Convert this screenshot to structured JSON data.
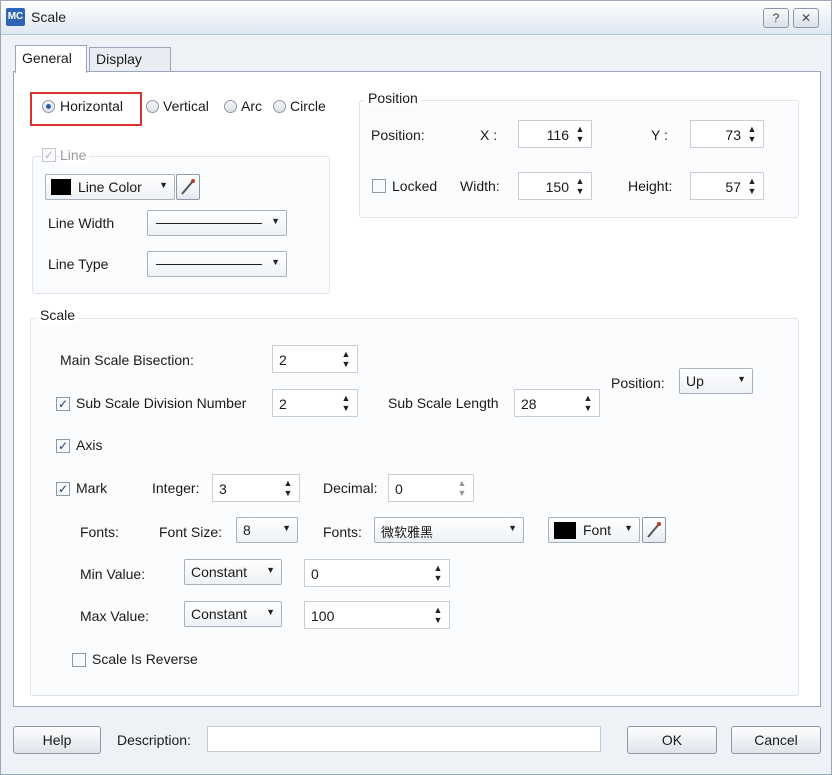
{
  "window": {
    "title": "Scale",
    "app_badge": "MC",
    "help_glyph": "?",
    "close_glyph": "✕"
  },
  "tabs": [
    {
      "label": "General",
      "active": true
    },
    {
      "label": "Display",
      "active": false
    }
  ],
  "shape": {
    "options": [
      "Horizontal",
      "Vertical",
      "Arc",
      "Circle"
    ],
    "selected": "Horizontal"
  },
  "line_group": {
    "title": "Line",
    "enabled": true,
    "color_button_label": "Line Color",
    "line_width_label": "Line Width",
    "line_type_label": "Line Type"
  },
  "position_group": {
    "title": "Position",
    "position_label": "Position:",
    "x_label": "X :",
    "x_value": "116",
    "y_label": "Y :",
    "y_value": "73",
    "locked_label": "Locked",
    "locked": false,
    "width_label": "Width:",
    "width_value": "150",
    "height_label": "Height:",
    "height_value": "57"
  },
  "scale_group": {
    "title": "Scale",
    "main_bisection_label": "Main Scale Bisection:",
    "main_bisection_value": "2",
    "sub_division_label": "Sub Scale Division Number",
    "sub_division_checked": true,
    "sub_division_value": "2",
    "sub_length_label": "Sub Scale Length",
    "sub_length_value": "28",
    "position_label": "Position:",
    "position_value": "Up",
    "axis_label": "Axis",
    "axis_checked": true,
    "mark_label": "Mark",
    "mark_checked": true,
    "integer_label": "Integer:",
    "integer_value": "3",
    "decimal_label": "Decimal:",
    "decimal_value": "0",
    "fonts_row_label": "Fonts:",
    "font_size_label": "Font Size:",
    "font_size_value": "8",
    "fonts_label": "Fonts:",
    "fonts_value": "微软雅黑",
    "font_color_label": "Font",
    "min_value_label": "Min Value:",
    "min_mode": "Constant",
    "min_value": "0",
    "max_value_label": "Max Value:",
    "max_mode": "Constant",
    "max_value": "100",
    "reverse_label": "Scale Is Reverse",
    "reverse_checked": false
  },
  "footer": {
    "help_label": "Help",
    "description_label": "Description:",
    "description_value": "",
    "ok_label": "OK",
    "cancel_label": "Cancel"
  },
  "icons": {
    "spin": "spin-arrows-icon",
    "dropdown": "dropdown-arrow-icon",
    "picker": "eyedropper-icon"
  }
}
